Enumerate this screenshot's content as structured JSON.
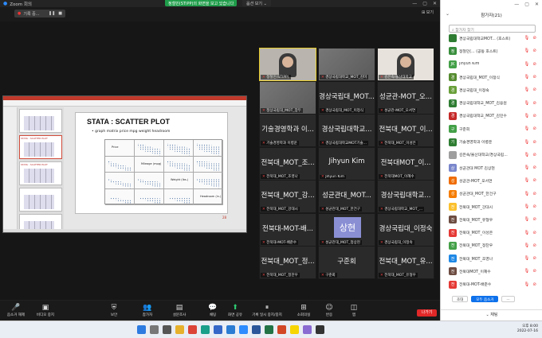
{
  "window": {
    "title": "Zoom 회의"
  },
  "banner": {
    "share_text": "정철민(STIPP)의 화면을 보고 있습니다",
    "options_label": "옵션 보기 ⌄"
  },
  "mini_toolbar": {
    "label": "기록 중..."
  },
  "view_label": "보기",
  "shared_slide": {
    "title": "STATA : SCATTER PLOT",
    "bullet": "graph matrix price mpg weight headroom",
    "matrix_labels": [
      "Price",
      "Mileage (mpg)",
      "Weight (lbs.)",
      "Headroom (in.)"
    ],
    "slide_number": "28"
  },
  "tiles": [
    {
      "big": "",
      "name": "정철민(STIPP)",
      "kind": "video"
    },
    {
      "big": "",
      "name": "경상국립대학교_MOT_김미",
      "kind": "blur"
    },
    {
      "big": "",
      "name": "김은숙/울산대학교",
      "kind": "video2"
    },
    {
      "big": "",
      "name": "정상국립대_MOT_장두",
      "kind": "blur"
    },
    {
      "big": "경상국립대_MOT...",
      "name": "경상국립대_MOT_이정식",
      "kind": "text"
    },
    {
      "big": "성균관-MOT_오...",
      "name": "성균관-MOT_오서연",
      "kind": "text"
    },
    {
      "big": "기술경영학과 이...",
      "name": "기술경영학과 이병운",
      "kind": "text"
    },
    {
      "big": "경상국립대학교...",
      "name": "경상국립대학교MOT기술...",
      "kind": "text"
    },
    {
      "big": "전북대_MOT_이...",
      "name": "전북대_MOT_이성은",
      "kind": "text"
    },
    {
      "big": "전북대_MOT_조...",
      "name": "전북대_MOT_조영나",
      "kind": "text"
    },
    {
      "big": "Jihyun Kim",
      "name": "Jihyun Kim",
      "kind": "text"
    },
    {
      "big": "전북대MOT_이...",
      "name": "전북대MOT_이혜수",
      "kind": "text"
    },
    {
      "big": "전북대_MOT_강...",
      "name": "전북대_MOT_강대시",
      "kind": "text"
    },
    {
      "big": "성균관대_MOT...",
      "name": "성균관대_MOT_한건구",
      "kind": "text"
    },
    {
      "big": "경상국립대학교...",
      "name": "경상국립대학교_MOT_...",
      "kind": "text"
    },
    {
      "big": "전북대-MOT-배...",
      "name": "전북대-MOT-배준수",
      "kind": "text"
    },
    {
      "big": "상현",
      "name": "성균관대_MOT_정상현",
      "kind": "avatar"
    },
    {
      "big": "경상국립대_이정숙",
      "name": "경상국립대_이정숙",
      "kind": "text"
    },
    {
      "big": "전북대_MOT_정...",
      "name": "전북대_MOT_정찬우",
      "kind": "text"
    },
    {
      "big": "구준회",
      "name": "구준회",
      "kind": "text"
    },
    {
      "big": "전북대_MOT_유...",
      "name": "전북대_MOT_유형우",
      "kind": "text"
    }
  ],
  "bottom_bar": [
    {
      "label": "음소거 해제",
      "icon": "🎤"
    },
    {
      "label": "비디오 중지",
      "icon": "▣"
    },
    {
      "label": "보안",
      "icon": "⛨"
    },
    {
      "label": "참가자",
      "icon": "👥"
    },
    {
      "label": "설문조사",
      "icon": "▤"
    },
    {
      "label": "채팅",
      "icon": "💬"
    },
    {
      "label": "화면 공유",
      "icon": "⬆"
    },
    {
      "label": "기록 일시 중지/중지",
      "icon": "⏸"
    },
    {
      "label": "소회의실",
      "icon": "⊞"
    },
    {
      "label": "반응",
      "icon": "☺"
    },
    {
      "label": "앱",
      "icon": "◫"
    }
  ],
  "leave_label": "나가기",
  "panel": {
    "title": "참가자(21)",
    "search_placeholder": "참가자 찾기",
    "participants": [
      {
        "initial": "",
        "name": "경상국립대학교MOT... (호스트)",
        "color": "#2e7d32"
      },
      {
        "initial": "정",
        "name": "정철민(... (공동 호스트)",
        "color": "#388e3c"
      },
      {
        "initial": "JK",
        "name": "Jihyun Kim",
        "color": "#43a047"
      },
      {
        "initial": "경",
        "name": "경상국립대_MOT_이정식",
        "color": "#558b2f"
      },
      {
        "initial": "경",
        "name": "경상국립대_이정숙",
        "color": "#689f38"
      },
      {
        "initial": "경",
        "name": "경상국립대학교_MOT_김응원",
        "color": "#2e7d32"
      },
      {
        "initial": "경",
        "name": "경상국립대학교_MOT_김민수",
        "color": "#c62828"
      },
      {
        "initial": "구",
        "name": "구준회",
        "color": "#43a047"
      },
      {
        "initial": "기",
        "name": "기술경영학과 이병운",
        "color": "#2e7d32"
      },
      {
        "initial": "",
        "name": "김은숙/울산대학교/경상국립...",
        "color": "#9e9e9e"
      },
      {
        "initial": "상",
        "name": "성균관대 MOT 김상현",
        "color": "#7986cb"
      },
      {
        "initial": "성",
        "name": "성균관-MOT_오서연",
        "color": "#ef6c00"
      },
      {
        "initial": "성",
        "name": "성균관대_MOT_한건구",
        "color": "#f57c00"
      },
      {
        "initial": "전",
        "name": "전북대_MOT_강대시",
        "color": "#fbc02d"
      },
      {
        "initial": "전",
        "name": "전북대_MOT_유형우",
        "color": "#6d4c41"
      },
      {
        "initial": "전",
        "name": "전북대_MOT_이성은",
        "color": "#e53935"
      },
      {
        "initial": "전",
        "name": "전북대_MOT_정찬우",
        "color": "#43a047"
      },
      {
        "initial": "전",
        "name": "전북대_MOT_조영나",
        "color": "#1e88e5"
      },
      {
        "initial": "전",
        "name": "전북대MOT_이혜수",
        "color": "#6d4c41"
      },
      {
        "initial": "전",
        "name": "전북대-MOT-배준수",
        "color": "#e53935"
      }
    ],
    "invite_label": "초대",
    "mute_all_label": "모두 음소거",
    "more_label": "...",
    "chat_label": "채팅"
  },
  "clock": {
    "time": "오후 8:00",
    "date": "2022-07-16"
  }
}
